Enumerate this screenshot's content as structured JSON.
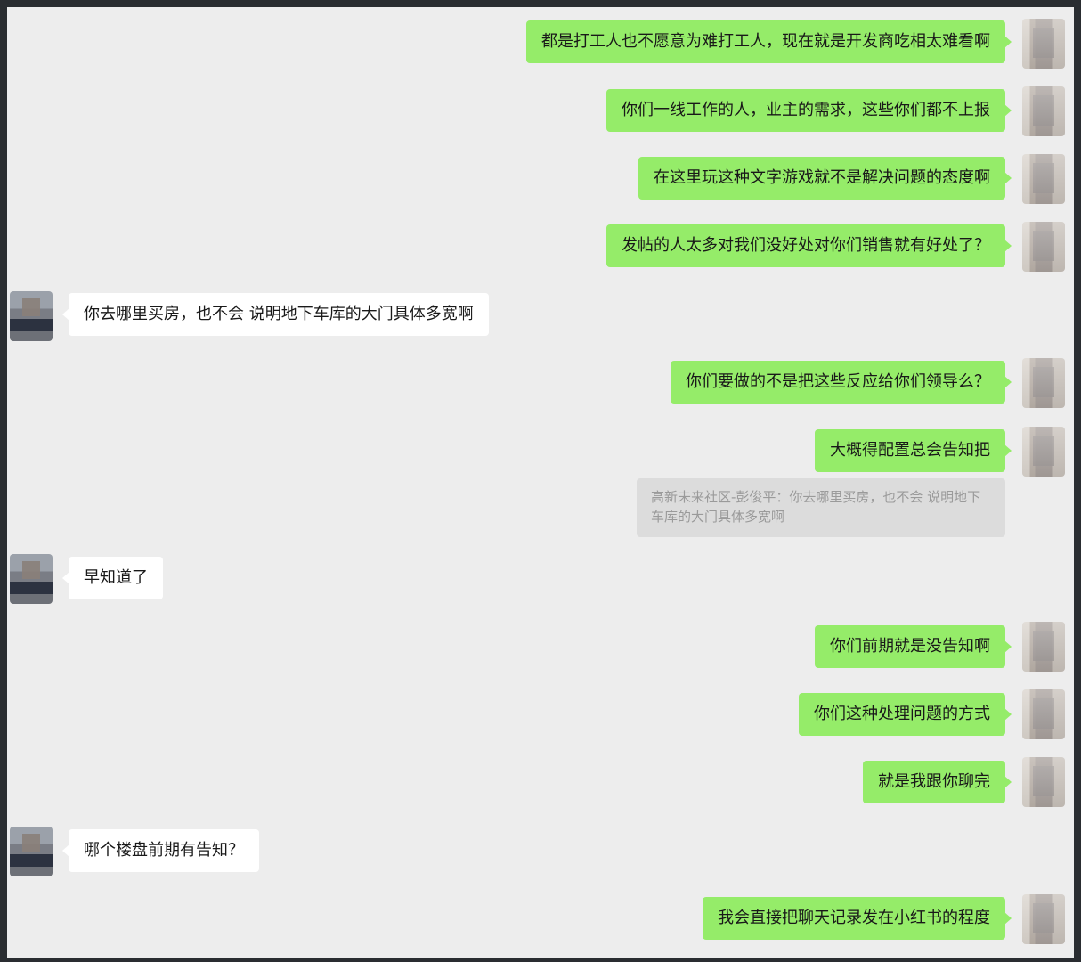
{
  "messages": [
    {
      "side": "out",
      "text": "都是打工人也不愿意为难打工人，现在就是开发商吃相太难看啊"
    },
    {
      "side": "out",
      "text": "你们一线工作的人，业主的需求，这些你们都不上报"
    },
    {
      "side": "out",
      "text": "在这里玩这种文字游戏就不是解决问题的态度啊"
    },
    {
      "side": "out",
      "text": "发帖的人太多对我们没好处对你们销售就有好处了？"
    },
    {
      "side": "in",
      "text": "你去哪里买房，也不会 说明地下车库的大门具体多宽啊"
    },
    {
      "side": "out",
      "text": "你们要做的不是把这些反应给你们领导么？"
    },
    {
      "side": "out",
      "text": "大概得配置总会告知把"
    },
    {
      "side": "in",
      "text": "早知道了"
    },
    {
      "side": "out",
      "text": "你们前期就是没告知啊"
    },
    {
      "side": "out",
      "text": "你们这种处理问题的方式"
    },
    {
      "side": "out",
      "text": "就是我跟你聊完"
    },
    {
      "side": "in",
      "text": "哪个楼盘前期有告知？"
    },
    {
      "side": "out",
      "text": "我会直接把聊天记录发在小红书的程度"
    }
  ],
  "quote": {
    "text": "高新未来社区-彭俊平：你去哪里买房，也不会 说明地下车库的大门具体多宽啊"
  }
}
